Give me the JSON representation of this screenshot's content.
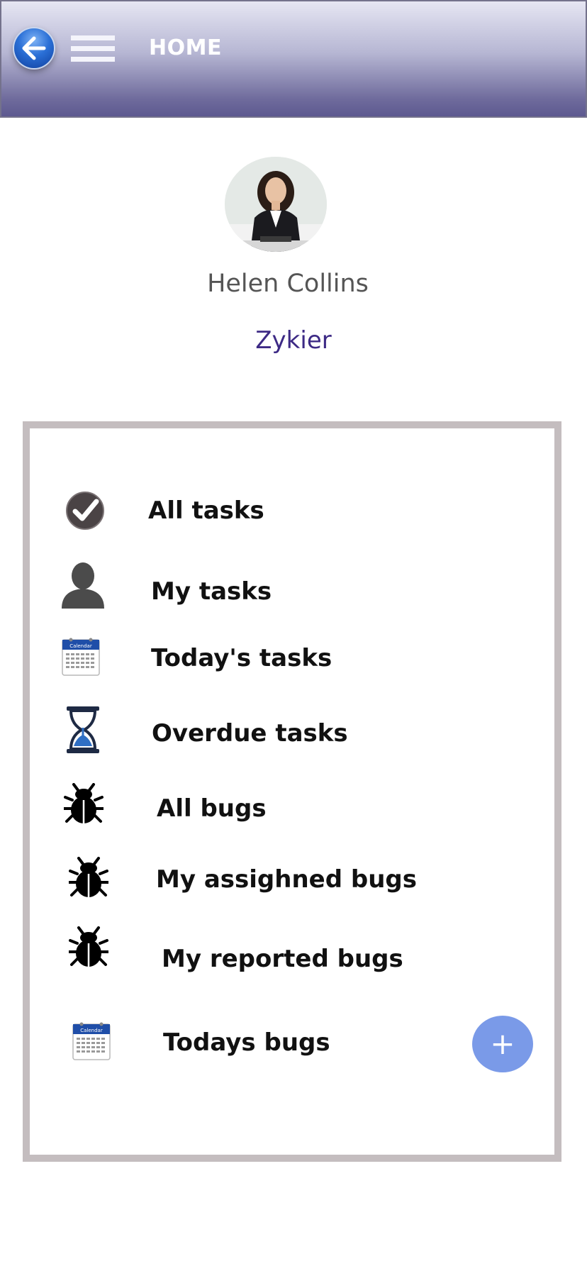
{
  "header": {
    "title": "HOME",
    "background_top": "#e6e6f3",
    "background_bottom": "#5d5990"
  },
  "profile": {
    "name": "Helen Collins",
    "organization": "Zykier"
  },
  "menu": {
    "items": [
      {
        "label": "All tasks",
        "icon": "checkmark-icon"
      },
      {
        "label": "My tasks",
        "icon": "person-icon"
      },
      {
        "label": "Today's tasks",
        "icon": "calendar-icon"
      },
      {
        "label": "Overdue tasks",
        "icon": "hourglass-icon"
      },
      {
        "label": "All bugs",
        "icon": "bug-icon"
      },
      {
        "label": "My assighned bugs",
        "icon": "bug-icon"
      },
      {
        "label": "My reported bugs",
        "icon": "bug-icon"
      },
      {
        "label": "Todays bugs",
        "icon": "calendar-icon"
      }
    ],
    "calendar_word": "Calendar"
  },
  "fab": {
    "label": "+",
    "color": "#7a9ae8"
  },
  "colors": {
    "organization_text": "#3d2a85",
    "panel_border": "#c4bdbf"
  }
}
